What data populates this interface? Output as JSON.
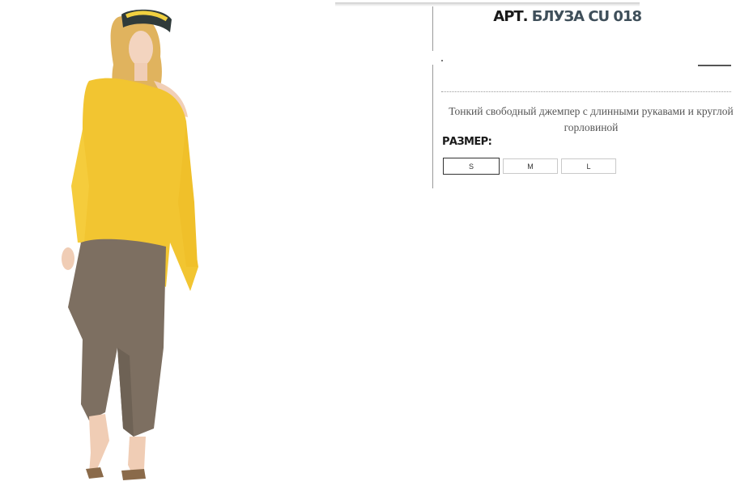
{
  "product": {
    "title_prefix": "АРТ.",
    "title_name": "БЛУЗА CU 018",
    "description": "Тонкий свободный джемпер с длинными рукавами и круглой горловиной",
    "size_label": "РАЗМЕР:",
    "sizes": [
      "S",
      "M",
      "L"
    ],
    "selected_size": "S"
  },
  "colors": {
    "sweater": "#f2c531",
    "trousers": "#7d6f61",
    "title_accent": "#3f4f5a"
  }
}
